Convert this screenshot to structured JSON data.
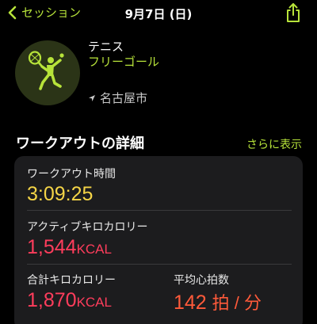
{
  "nav": {
    "back_label": "セッション",
    "title": "9月7日 (日)"
  },
  "activity": {
    "type": "テニス",
    "subtype": "フリーゴール",
    "location": "名古屋市",
    "icon": "tennis-player-icon"
  },
  "section": {
    "title": "ワークアウトの詳細",
    "more_label": "さらに表示"
  },
  "metrics": {
    "workout_time": {
      "label": "ワークアウト時間",
      "value": "3:09:25",
      "color": "#f5d547"
    },
    "active_kcal": {
      "label": "アクティブキロカロリー",
      "value": "1,544",
      "unit": "KCAL",
      "color": "#ff3d5c"
    },
    "total_kcal": {
      "label": "合計キロカロリー",
      "value": "1,870",
      "unit": "KCAL",
      "color": "#ff3d5c"
    },
    "avg_hr": {
      "label": "平均心拍数",
      "value": "142",
      "unit": "拍 / 分",
      "color": "#ff5a3a"
    }
  },
  "colors": {
    "accent": "#b7e33a",
    "background": "#000000",
    "card": "#1c1c1e"
  }
}
